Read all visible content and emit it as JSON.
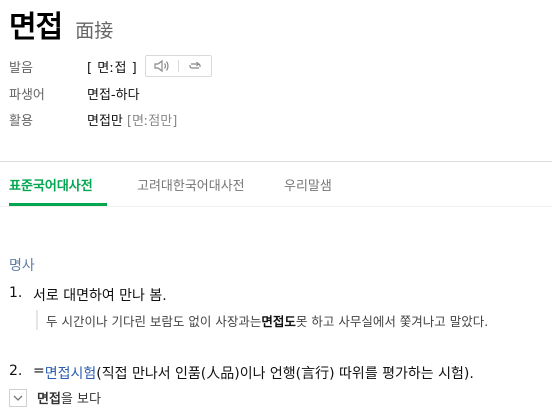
{
  "headword": {
    "title": "면접",
    "hanja": "面接"
  },
  "info": {
    "pronunciation_label": "발음",
    "pronunciation_value": "[ 면ː접 ]",
    "derivative_label": "파생어",
    "derivative_value": "면접-하다",
    "inflection_label": "활용",
    "inflection_value": "면접만",
    "inflection_pron": "[면ː점만]"
  },
  "tabs": [
    "표준국어대사전",
    "고려대한국어대사전",
    "우리말샘"
  ],
  "entry": {
    "pos": "명사",
    "sense1_num": "1.",
    "sense1_text": "서로 대면하여 만나 봄.",
    "example1_pre": "두 시간이나 기다린 보람도 없이 사장과는 ",
    "example1_bold": "면접도",
    "example1_post": " 못 하고 사무실에서 쫓겨나고 말았다.",
    "sense2_num": "2.",
    "sense2_prefix": "=",
    "sense2_link": "면접시험",
    "sense2_text": "(직접 만나서 인품(人品)이나 언행(言行) 따위를 평가하는 시험).",
    "colloc_bold": "면접",
    "colloc_text": "을 보다"
  },
  "colors": {
    "accent": "#03a650",
    "pos": "#5f7fa7",
    "link": "#2a5db0"
  }
}
